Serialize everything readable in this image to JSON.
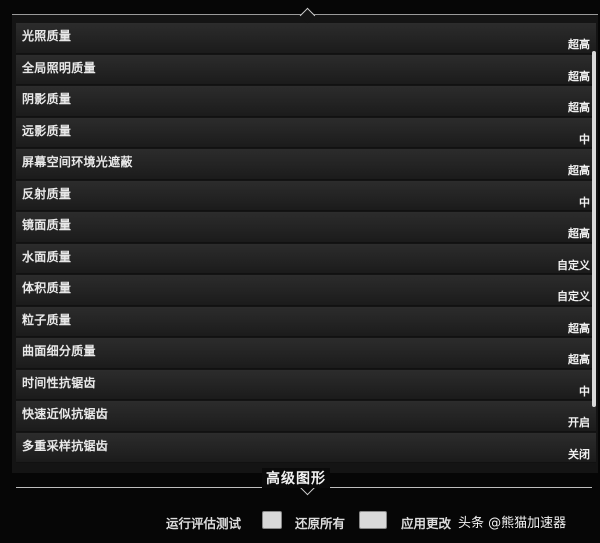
{
  "settings": {
    "rows": [
      {
        "label": "光照质量",
        "value": "超高"
      },
      {
        "label": "全局照明质量",
        "value": "超高"
      },
      {
        "label": "阴影质量",
        "value": "超高"
      },
      {
        "label": "远影质量",
        "value": "中"
      },
      {
        "label": "屏幕空间环境光遮蔽",
        "value": "超高"
      },
      {
        "label": "反射质量",
        "value": "中"
      },
      {
        "label": "镜面质量",
        "value": "超高"
      },
      {
        "label": "水面质量",
        "value": "自定义"
      },
      {
        "label": "体积质量",
        "value": "自定义"
      },
      {
        "label": "粒子质量",
        "value": "超高"
      },
      {
        "label": "曲面细分质量",
        "value": "超高"
      },
      {
        "label": "时间性抗锯齿",
        "value": "中"
      },
      {
        "label": "快速近似抗锯齿",
        "value": "开启"
      },
      {
        "label": "多重采样抗锯齿",
        "value": "关闭"
      }
    ]
  },
  "section": {
    "title": "高级图形"
  },
  "footer": {
    "run_benchmark": "运行评估测试",
    "restore_all": "还原所有",
    "apply_changes": "应用更改",
    "watermark": "头条 @熊猫加速器"
  }
}
